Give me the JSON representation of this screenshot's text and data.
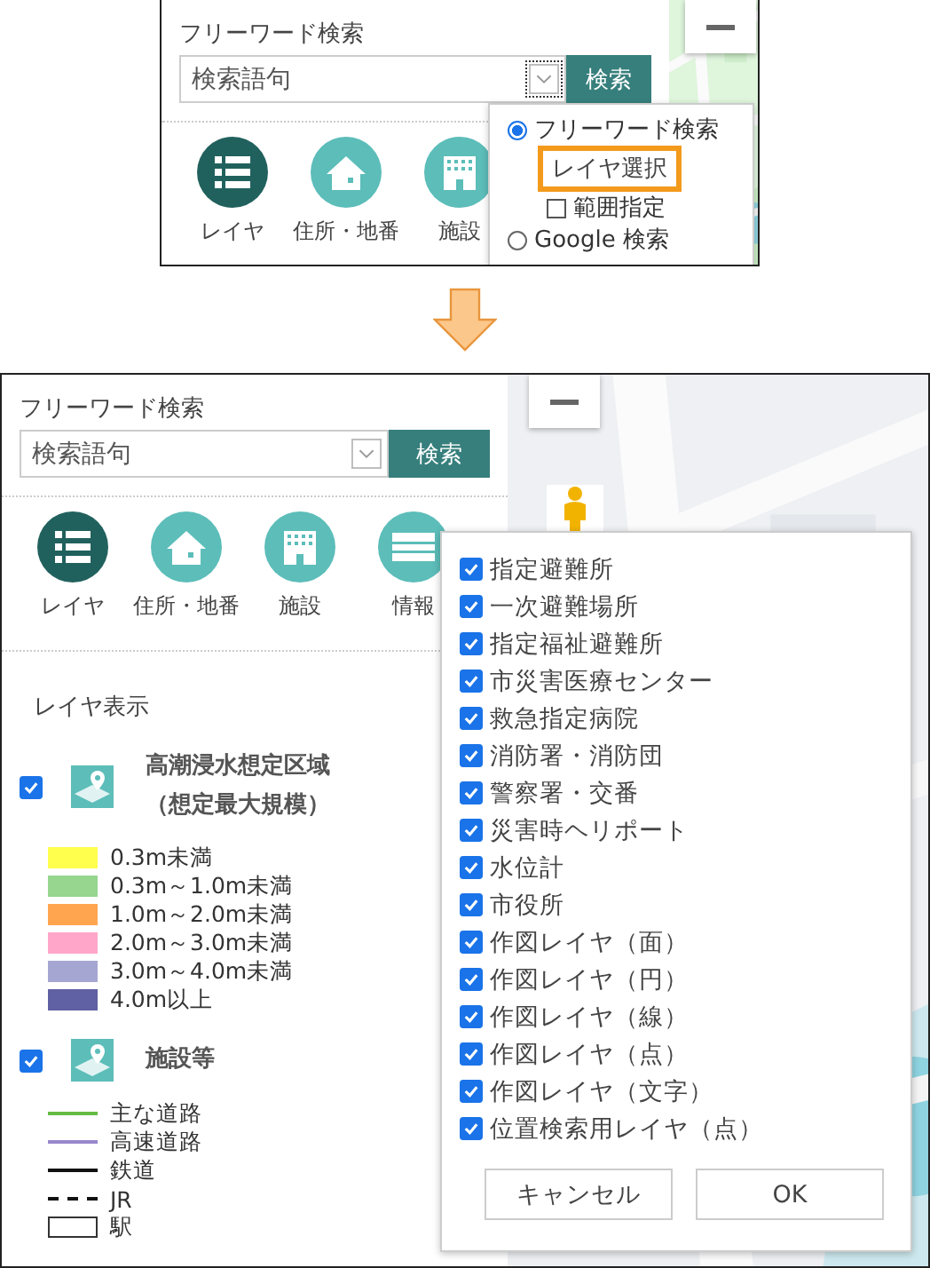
{
  "top_panel": {
    "search_label": "フリーワード検索",
    "search_placeholder": "検索語句",
    "search_button": "検索",
    "tools": [
      {
        "label": "レイヤ",
        "selected": true
      },
      {
        "label": "住所・地番",
        "selected": false
      },
      {
        "label": "施設",
        "selected": false
      }
    ],
    "search_menu": [
      {
        "kind": "radio",
        "label": "フリーワード検索",
        "selected": true
      },
      {
        "kind": "action",
        "label": "レイヤ選択",
        "highlighted": true
      },
      {
        "kind": "checkbox",
        "label": "範囲指定",
        "checked": false
      },
      {
        "kind": "radio",
        "label": "Google 検索",
        "selected": false
      }
    ]
  },
  "bottom_panel": {
    "search_label": "フリーワード検索",
    "search_placeholder": "検索語句",
    "search_button": "検索",
    "tools": [
      {
        "label": "レイヤ",
        "selected": true
      },
      {
        "label": "住所・地番",
        "selected": false
      },
      {
        "label": "施設",
        "selected": false
      },
      {
        "label": "情報",
        "selected": false
      }
    ],
    "layer_title": "レイヤ表示",
    "layer_groups": [
      {
        "title_lines": [
          "高潮浸水想定区域",
          "（想定最大規模）"
        ],
        "checked": true,
        "legend": [
          {
            "kind": "swatch",
            "color": "#ffff4d",
            "label": "0.3m未満"
          },
          {
            "kind": "swatch",
            "color": "#96d68e",
            "label": "0.3m～1.0m未満"
          },
          {
            "kind": "swatch",
            "color": "#ffa54f",
            "label": "1.0m～2.0m未満"
          },
          {
            "kind": "swatch",
            "color": "#ffa6c9",
            "label": "2.0m～3.0m未満"
          },
          {
            "kind": "swatch",
            "color": "#a6a6d2",
            "label": "3.0m～4.0m未満"
          },
          {
            "kind": "swatch",
            "color": "#6060a4",
            "label": "4.0m以上"
          }
        ]
      },
      {
        "title_lines": [
          "施設等"
        ],
        "checked": true,
        "legend": [
          {
            "kind": "line",
            "color": "#66bb44",
            "label": "主な道路"
          },
          {
            "kind": "line",
            "color": "#9988cc",
            "label": "高速道路"
          },
          {
            "kind": "line",
            "color": "#111111",
            "label": "鉄道"
          },
          {
            "kind": "dashed",
            "color": "#111111",
            "label": "JR"
          },
          {
            "kind": "box",
            "color": "#333333",
            "label": "駅"
          }
        ]
      }
    ],
    "layer_dialog": {
      "items": [
        {
          "label": "指定避難所",
          "checked": true
        },
        {
          "label": "一次避難場所",
          "checked": true
        },
        {
          "label": "指定福祉避難所",
          "checked": true
        },
        {
          "label": "市災害医療センター",
          "checked": true
        },
        {
          "label": "救急指定病院",
          "checked": true
        },
        {
          "label": "消防署・消防団",
          "checked": true
        },
        {
          "label": "警察署・交番",
          "checked": true
        },
        {
          "label": "災害時ヘリポート",
          "checked": true
        },
        {
          "label": "水位計",
          "checked": true
        },
        {
          "label": "市役所",
          "checked": true
        },
        {
          "label": "作図レイヤ（面）",
          "checked": true
        },
        {
          "label": "作図レイヤ（円）",
          "checked": true
        },
        {
          "label": "作図レイヤ（線）",
          "checked": true
        },
        {
          "label": "作図レイヤ（点）",
          "checked": true
        },
        {
          "label": "作図レイヤ（文字）",
          "checked": true
        },
        {
          "label": "位置検索用レイヤ（点）",
          "checked": true
        }
      ],
      "buttons": [
        "キャンセル",
        "OK"
      ]
    }
  }
}
